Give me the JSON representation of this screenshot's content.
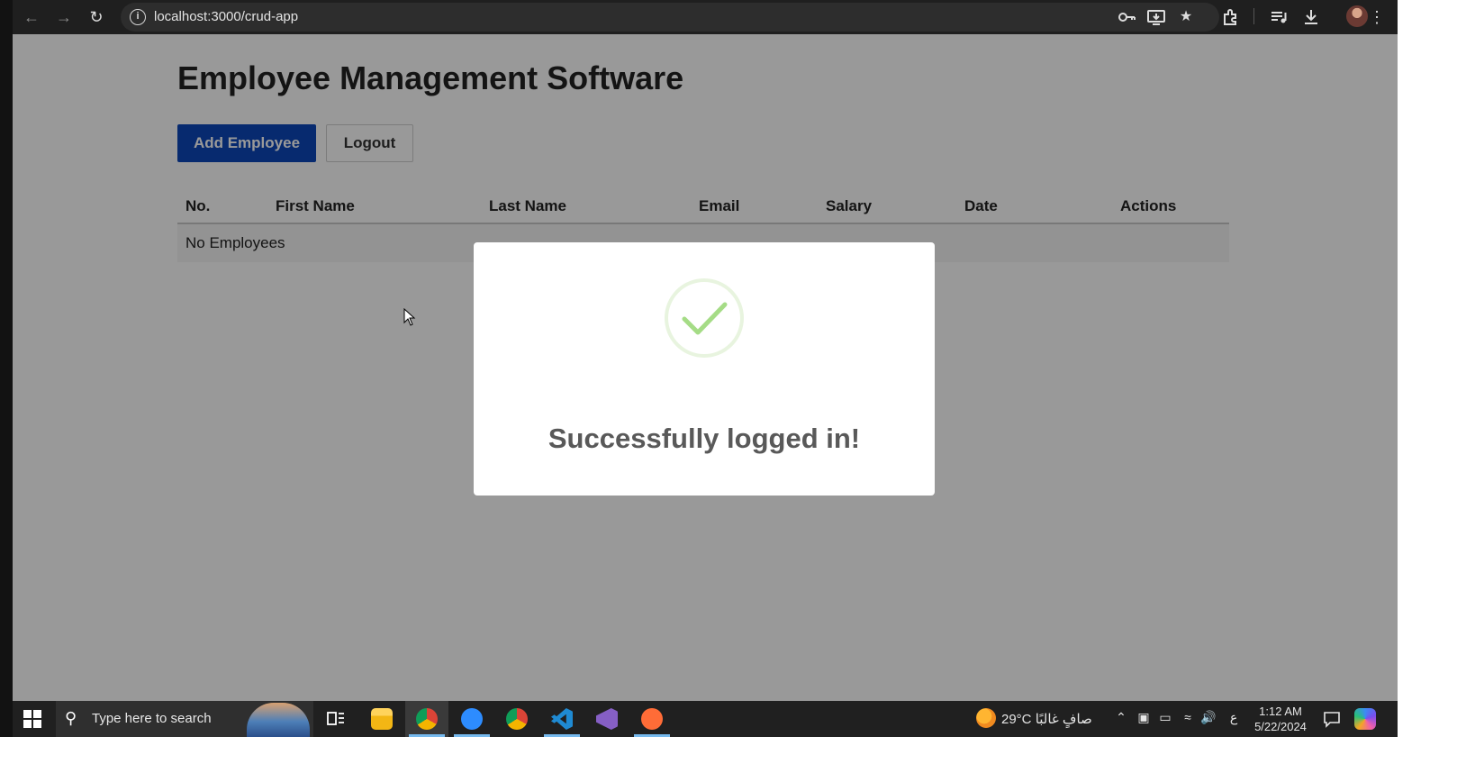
{
  "browser": {
    "url": "localhost:3000/crud-app"
  },
  "page": {
    "title": "Employee Management Software",
    "add_button_label": "Add Employee",
    "logout_button_label": "Logout",
    "table": {
      "headers": [
        "No.",
        "First Name",
        "Last Name",
        "Email",
        "Salary",
        "Date",
        "Actions"
      ],
      "empty_message": "No Employees"
    }
  },
  "modal": {
    "message": "Successfully logged in!",
    "icon": "success-check-icon",
    "accent_color": "#a5dc86"
  },
  "taskbar": {
    "search_placeholder": "Type here to search",
    "weather": "29°C  صافٍ غالبًا",
    "language": "ع",
    "time": "1:12 AM",
    "date": "5/22/2024",
    "apps": [
      "task-view",
      "file-explorer",
      "chrome",
      "zoom",
      "chrome-profile",
      "vscode",
      "visual-studio",
      "postman"
    ]
  }
}
